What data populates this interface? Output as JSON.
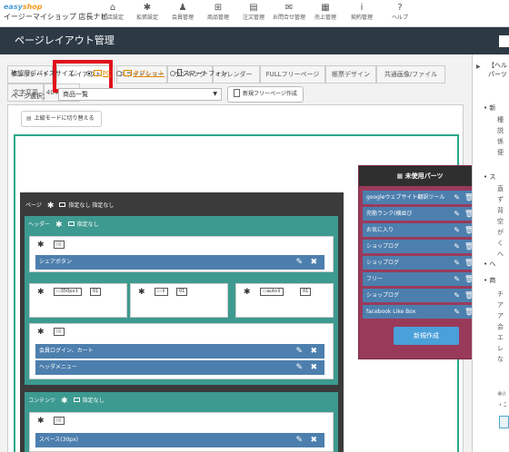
{
  "app": {
    "brand_1": "easy",
    "brand_2": "shop",
    "shop_name": "イージーマイショップ 店長ナビ"
  },
  "nav": [
    {
      "icon": "house-icon",
      "glyph": "⌂",
      "label": "閲店設定"
    },
    {
      "icon": "gear-icon",
      "glyph": "✱",
      "label": "拡張設定"
    },
    {
      "icon": "person-icon",
      "glyph": "♟",
      "label": "会員管理"
    },
    {
      "icon": "gift-icon",
      "glyph": "⊞",
      "label": "商品管理"
    },
    {
      "icon": "document-icon",
      "glyph": "▤",
      "label": "注文管理"
    },
    {
      "icon": "envelope-icon",
      "glyph": "✉",
      "label": "お問合せ管理"
    },
    {
      "icon": "calculator-icon",
      "glyph": "▦",
      "label": "売上管理"
    },
    {
      "icon": "info-icon",
      "glyph": "i",
      "label": "契約管理"
    },
    {
      "icon": "help-icon",
      "glyph": "?",
      "label": "ヘルプ"
    }
  ],
  "page_title": "ページレイアウト管理",
  "tabs": [
    "テンプレート",
    "レイアウト",
    "スライドショー",
    "ランキング",
    "カレンダー",
    "FULLフリーページ",
    "帳票デザイン",
    "共通画像/ファイル",
    "文字変更",
    "404ページ"
  ],
  "active_tab": "レイアウト",
  "advanced_mode_button": "上級モードに切り替える",
  "device": {
    "label": "確認用デバイスサイズ：",
    "options": [
      "PC",
      "タブレット",
      "スマートフォン"
    ],
    "selected": "PC"
  },
  "page_select": {
    "label": "ページ選択：",
    "value": "商品一覧",
    "new_free_page_button": "新規フリーページ作成"
  },
  "layout": {
    "page_label": "ページ",
    "not_set": "指定なし",
    "not_set_pair": "指定なし 指定なし",
    "header_label": "ヘッダー",
    "content_label": "コンテンツ",
    "share_button_bar": "シェアボタン",
    "icon_small": "▯▯",
    "col_a": "▭350px⇕",
    "col_a2": "01",
    "col_b": "▭⇕",
    "col_b2": "01",
    "col_c": "▭auto⇕",
    "col_c2": "01",
    "member_login_cart": "会員ログイン、カート",
    "header_menu": "ヘッダメニュー",
    "space_bar": "スペース(30px)"
  },
  "unused_parts": {
    "title": "未使用パーツ",
    "items": [
      "googleウェブサイト翻訳ツール",
      "売筋ランク(横並び",
      "お気に入り",
      "ショップログ",
      "ショップログ",
      "フリー",
      "ショップログ",
      "facebook Like Box"
    ],
    "new_button": "新規作成"
  },
  "right_panel": {
    "text_1": "【ヘル",
    "text_2": "パーツ",
    "bullet_a": "新",
    "bullet_b": "ス",
    "bullet_c": "ヘ",
    "bullet_d": "商",
    "chars_1": "種説係便",
    "chars_2": "直ず背空がくへ",
    "chars_3": "チアア会エレな",
    "note": "※ﾊ",
    "note_2": "・ﾆ"
  },
  "colors": {
    "titlebar": "#2d3a46",
    "highlight": "#e0101a",
    "teal_frame": "#2aa88a",
    "section": "#3d9a90",
    "bar": "#4d7fae",
    "unused_panel": "#9a3a5a",
    "new_button": "#4aa0d8"
  }
}
